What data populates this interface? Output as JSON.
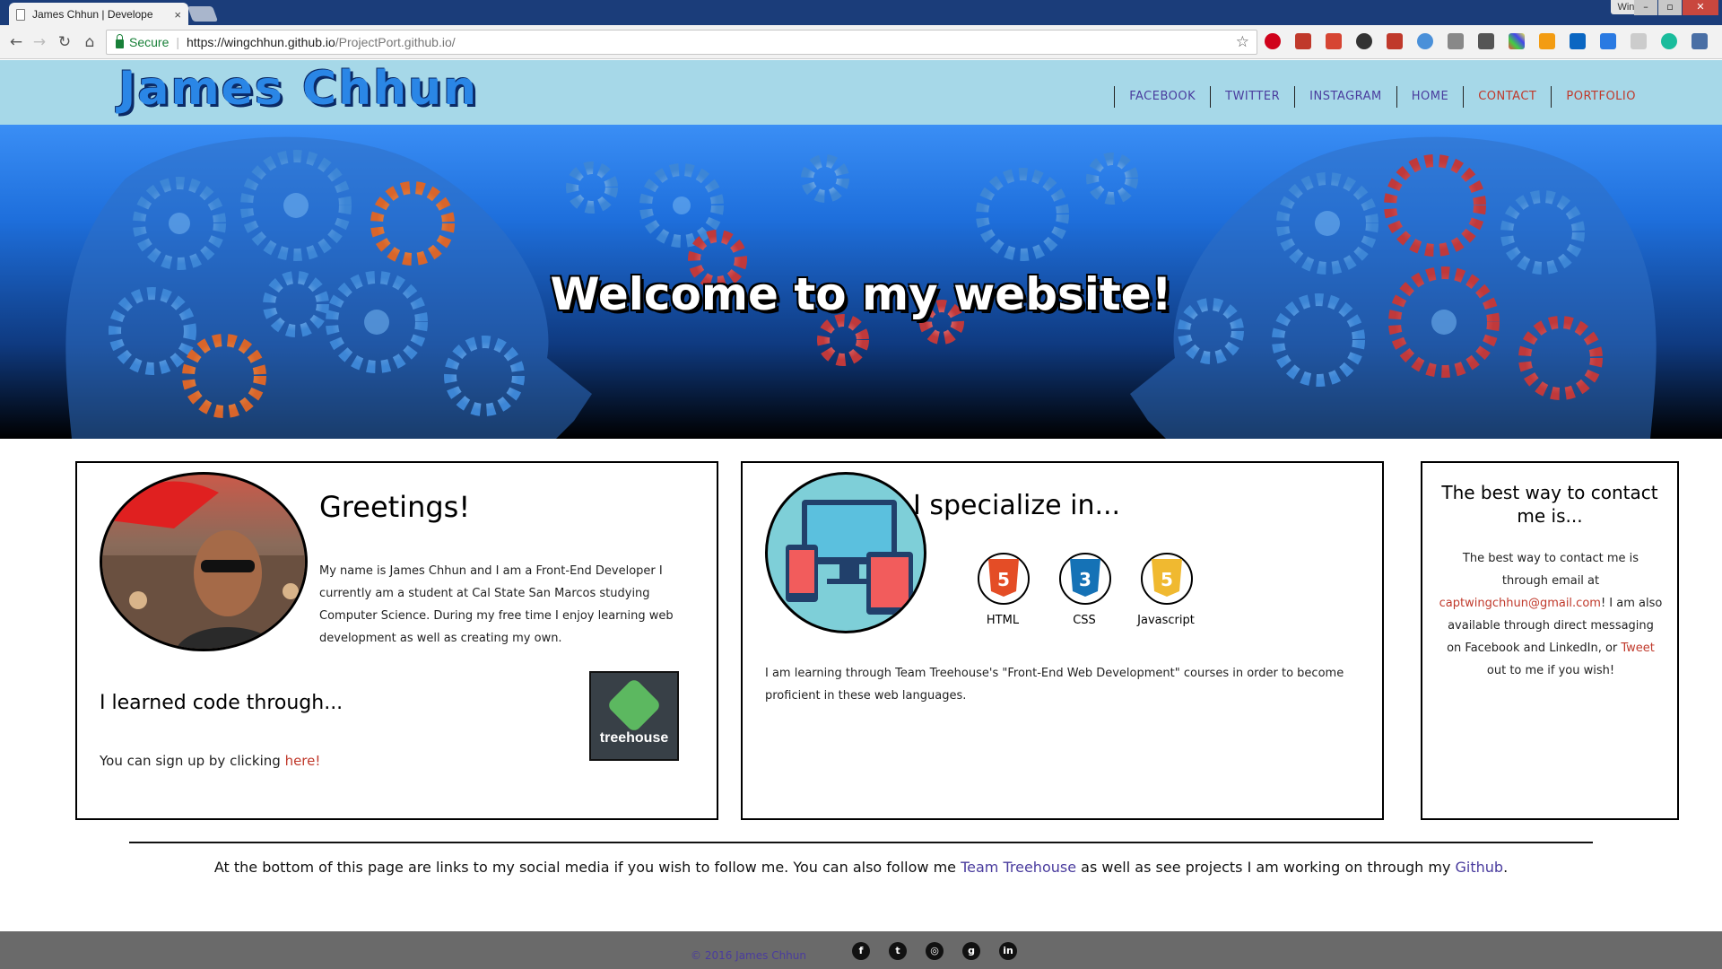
{
  "browser": {
    "tab_title": "James Chhun | Develope",
    "tab_close": "×",
    "user_name": "Wing",
    "secure_label": "Secure",
    "url_main": "https://wingchhun.github.io",
    "url_rest": "/ProjectPort.github.io/"
  },
  "header": {
    "logo": "James Chhun",
    "nav": [
      "FACEBOOK",
      "TWITTER",
      "INSTAGRAM",
      "HOME",
      "CONTACT",
      "PORTFOLIO"
    ]
  },
  "hero": {
    "title": "Welcome to my website!"
  },
  "greetings": {
    "title": "Greetings!",
    "body": "My name is James Chhun and I am a Front-End Developer I currently am a student at Cal State San Marcos studying Computer Science. During my free time I enjoy learning web development as well as creating my own.",
    "learned_title": "I learned code through...",
    "signup_text": "You can sign up by clicking ",
    "signup_link": "here!",
    "treehouse_label": "treehouse"
  },
  "specialize": {
    "title": "I specialize in...",
    "skills": [
      {
        "label": "HTML",
        "glyph": "5",
        "color": "#e44d26"
      },
      {
        "label": "CSS",
        "glyph": "3",
        "color": "#1572b6"
      },
      {
        "label": "Javascript",
        "glyph": "5",
        "color": "#f0db4f"
      }
    ],
    "body": "I am learning through Team Treehouse's \"Front-End Web Development\" courses in order to become proficient in these web languages."
  },
  "contact": {
    "title": "The best way to contact me is...",
    "text_1": "The best way to contact me is through email at ",
    "email": "captwingchhun@gmail.com",
    "text_2": "! I am also available through direct messaging on Facebook and LinkedIn, or ",
    "tweet": "Tweet",
    "text_3": " out to me if you wish!"
  },
  "footer_note": {
    "text_1": "At the bottom of this page are links to my social media if you wish to follow me. You can also follow me ",
    "link_1": "Team Treehouse",
    "text_2": " as well as see projects I am working on through my ",
    "link_2": "Github",
    "text_3": "."
  },
  "footer": {
    "copyright": "© 2016 James Chhun",
    "social": [
      {
        "icon": "facebook-icon",
        "glyph": "f"
      },
      {
        "icon": "twitter-icon",
        "glyph": "t"
      },
      {
        "icon": "instagram-icon",
        "glyph": "◎"
      },
      {
        "icon": "github-icon",
        "glyph": "g"
      },
      {
        "icon": "linkedin-icon",
        "glyph": "in"
      }
    ]
  },
  "colors": {
    "header_bg": "#a6d8e8",
    "logo": "#2a86e6",
    "nav_link": "#4a3c9e",
    "accent_red": "#c0392b",
    "footer_bg": "#6a6a6a"
  }
}
